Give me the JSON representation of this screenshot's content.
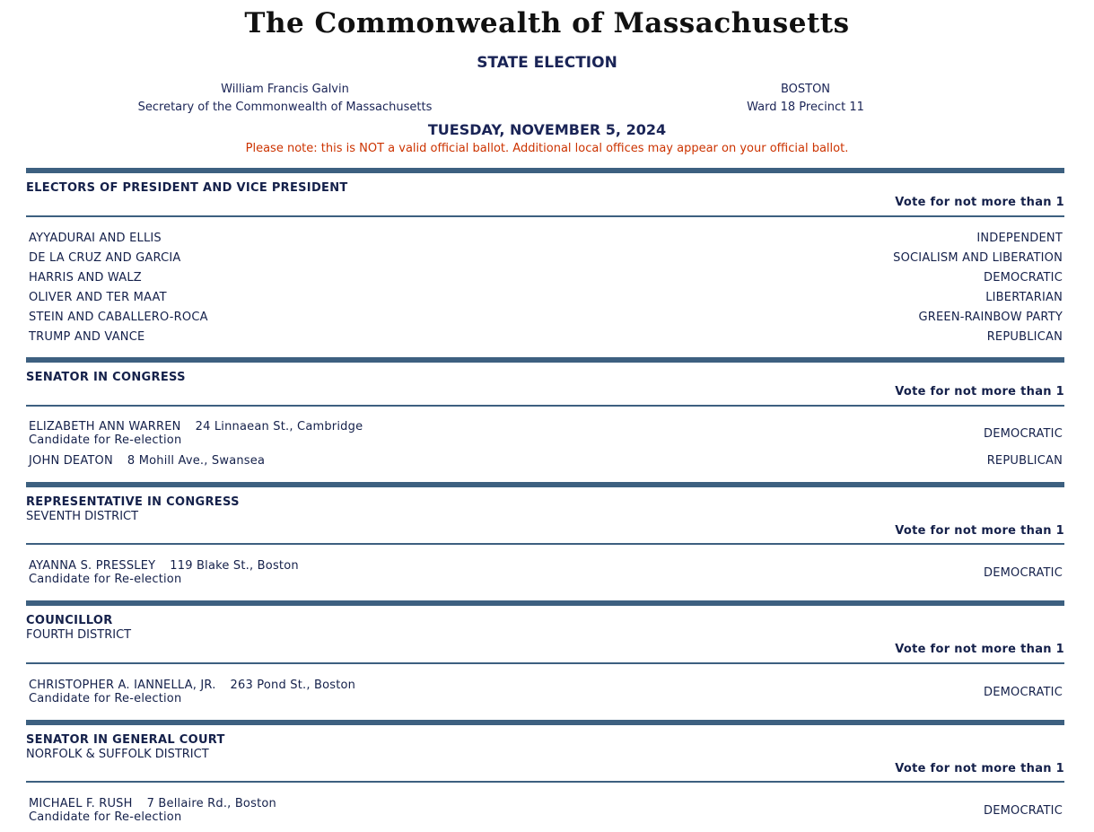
{
  "header": {
    "title": "The Commonwealth of Massachusetts",
    "subtitle": "STATE ELECTION",
    "official_name": "William Francis Galvin",
    "official_title": "Secretary of the Commonwealth of Massachusetts",
    "city": "BOSTON",
    "ward_precinct": "Ward 18 Precinct 11",
    "date": "TUESDAY, NOVEMBER 5, 2024",
    "note": "Please note: this is NOT a valid official ballot. Additional local offices may appear on your official ballot."
  },
  "vote_instruction": "Vote for not more than 1",
  "races": [
    {
      "office": "ELECTORS OF PRESIDENT AND VICE PRESIDENT",
      "candidates": [
        {
          "name": "AYYADURAI AND ELLIS",
          "party": "INDEPENDENT"
        },
        {
          "name": "DE LA CRUZ AND GARCIA",
          "party": "SOCIALISM AND LIBERATION"
        },
        {
          "name": "HARRIS AND WALZ",
          "party": "DEMOCRATIC"
        },
        {
          "name": "OLIVER AND TER MAAT",
          "party": "LIBERTARIAN"
        },
        {
          "name": "STEIN AND CABALLERO-ROCA",
          "party": "GREEN-RAINBOW PARTY"
        },
        {
          "name": "TRUMP AND VANCE",
          "party": "REPUBLICAN"
        }
      ]
    },
    {
      "office": "SENATOR IN CONGRESS",
      "candidates": [
        {
          "name": "ELIZABETH ANN WARREN",
          "address": "24 Linnaean St., Cambridge",
          "note": "Candidate for Re-election",
          "party": "DEMOCRATIC"
        },
        {
          "name": "JOHN DEATON",
          "address": "8 Mohill Ave., Swansea",
          "party": "REPUBLICAN"
        }
      ]
    },
    {
      "office": "REPRESENTATIVE IN CONGRESS",
      "district": "SEVENTH DISTRICT",
      "candidates": [
        {
          "name": "AYANNA S. PRESSLEY",
          "address": "119 Blake St., Boston",
          "note": "Candidate for Re-election",
          "party": "DEMOCRATIC"
        }
      ]
    },
    {
      "office": "COUNCILLOR",
      "district": "FOURTH DISTRICT",
      "candidates": [
        {
          "name": "CHRISTOPHER A. IANNELLA, JR.",
          "address": "263 Pond St., Boston",
          "note": "Candidate for Re-election",
          "party": "DEMOCRATIC"
        }
      ]
    },
    {
      "office": "SENATOR IN GENERAL COURT",
      "district": "NORFOLK & SUFFOLK DISTRICT",
      "candidates": [
        {
          "name": "MICHAEL F. RUSH",
          "address": "7 Bellaire Rd., Boston",
          "note": "Candidate for Re-election",
          "party": "DEMOCRATIC"
        }
      ]
    }
  ]
}
